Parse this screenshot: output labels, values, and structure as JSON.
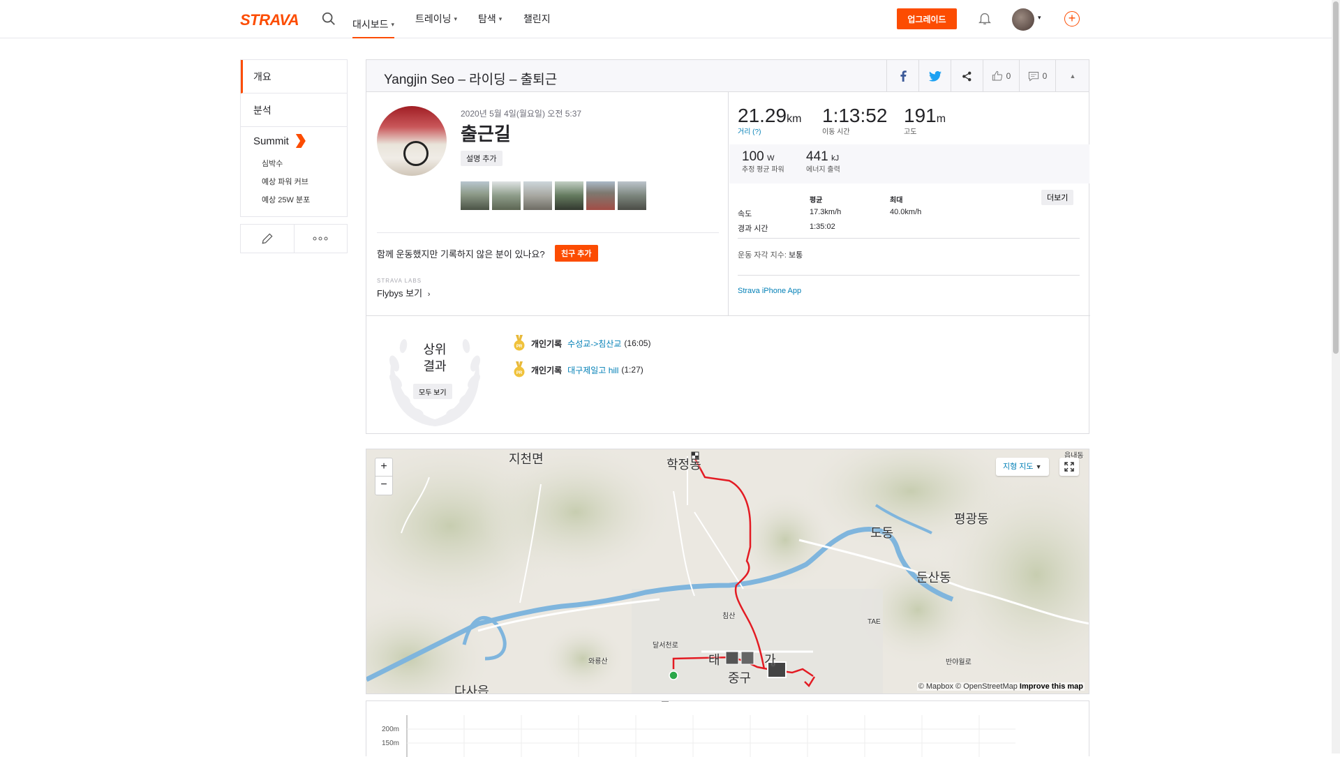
{
  "nav": {
    "logo": "STRAVA",
    "items": [
      "대시보드",
      "트레이닝",
      "탐색",
      "챌린지"
    ],
    "upgrade": "업그레이드"
  },
  "sidebar": {
    "overview": "개요",
    "analysis": "분석",
    "summit": "Summit",
    "summit_items": [
      "심박수",
      "예상 파워 커브",
      "예상 25W 분포"
    ]
  },
  "activity": {
    "header_title": "Yangjin Seo – 라이딩 – 출퇴근",
    "kudos_count": "0",
    "comment_count": "0",
    "date": "2020년 5월 4일(월요일) 오전 5:37",
    "name": "출근길",
    "add_description": "설명 추가",
    "invite_text": "함께 운동했지만 기록하지 않은 분이 있나요?",
    "add_friend": "친구 추가",
    "labs_label": "STRAVA LABS",
    "flybys": "Flybys 보기"
  },
  "stats": {
    "distance_value": "21.29",
    "distance_unit": "km",
    "distance_label": "거리 (?)",
    "moving_time_value": "1:13:52",
    "moving_time_label": "이동 시간",
    "elevation_value": "191",
    "elevation_unit": "m",
    "elevation_label": "고도",
    "power_value": "100",
    "power_unit": "W",
    "power_label": "추정 평균 파워",
    "energy_value": "441",
    "energy_unit": "kJ",
    "energy_label": "에너지 출력",
    "more_button": "더보기",
    "col_avg": "평균",
    "col_max": "최대",
    "speed_label": "속도",
    "speed_avg": "17.3km/h",
    "speed_max": "40.0km/h",
    "elapsed_label": "경과 시간",
    "elapsed_avg": "1:35:02",
    "rpe_label": "운동 자각 지수:",
    "rpe_value": "보통",
    "device": "Strava iPhone App"
  },
  "results": {
    "title_line1": "상위",
    "title_line2": "결과",
    "see_all": "모두 보기",
    "prs": [
      {
        "label": "개인기록",
        "segment": "수성교->침산교",
        "time": "(16:05)"
      },
      {
        "label": "개인기록",
        "segment": "대구제일고 hill",
        "time": "(1:27)"
      }
    ]
  },
  "map": {
    "zoom_in": "+",
    "zoom_out": "−",
    "terrain": "지형 지도",
    "attribution_prefix": "© Mapbox © OpenStreetMap",
    "attribution_link": "Improve this map",
    "labels": [
      "지천면",
      "학정동",
      "도동",
      "평광동",
      "둔산동",
      "다사읍",
      "태",
      "가",
      "중구",
      "침산",
      "달서천로",
      "와룡산",
      "반야월로",
      "TAE",
      "읍내동"
    ]
  },
  "elevation_chart": {
    "y_ticks": [
      "200m",
      "150m"
    ]
  },
  "colors": {
    "brand": "#fc4c02",
    "link": "#007fb6",
    "route": "#e31b23"
  }
}
